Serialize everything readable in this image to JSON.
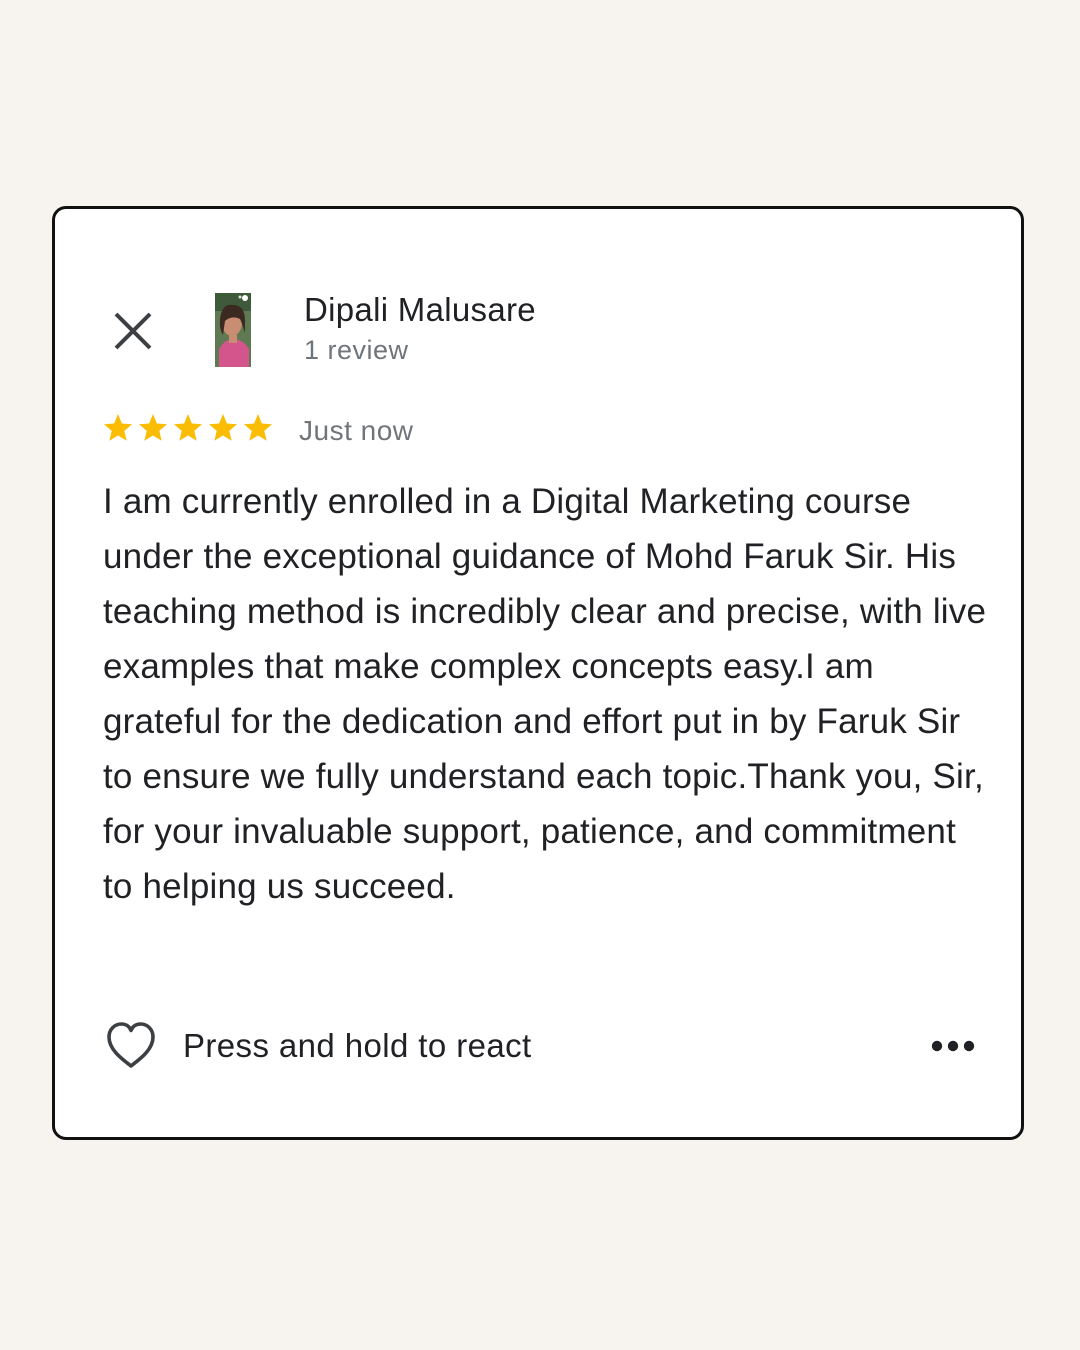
{
  "review": {
    "author_name": "Dipali Malusare",
    "review_count": "1 review",
    "rating": 5,
    "rating_max": 5,
    "timestamp": "Just now",
    "text": "I am currently enrolled in a Digital Marketing course under the exceptional guidance of Mohd Faruk Sir. His teaching method is incredibly clear and precise, with live examples that make complex concepts easy.I am grateful for the dedication and effort put in by Faruk Sir to ensure we fully understand each topic.Thank you, Sir, for your invaluable support, patience, and commitment to helping us succeed."
  },
  "actions": {
    "react_label": "Press and hold to react"
  },
  "icons": {
    "close": "close-icon",
    "star": "star-icon",
    "heart": "heart-outline-icon",
    "more": "more-horizontal-icon"
  },
  "colors": {
    "page_background": "#f7f4ef",
    "card_background": "#ffffff",
    "card_border": "#111111",
    "star": "#fbbc04",
    "primary_text": "#202124",
    "secondary_text": "#70757a"
  }
}
